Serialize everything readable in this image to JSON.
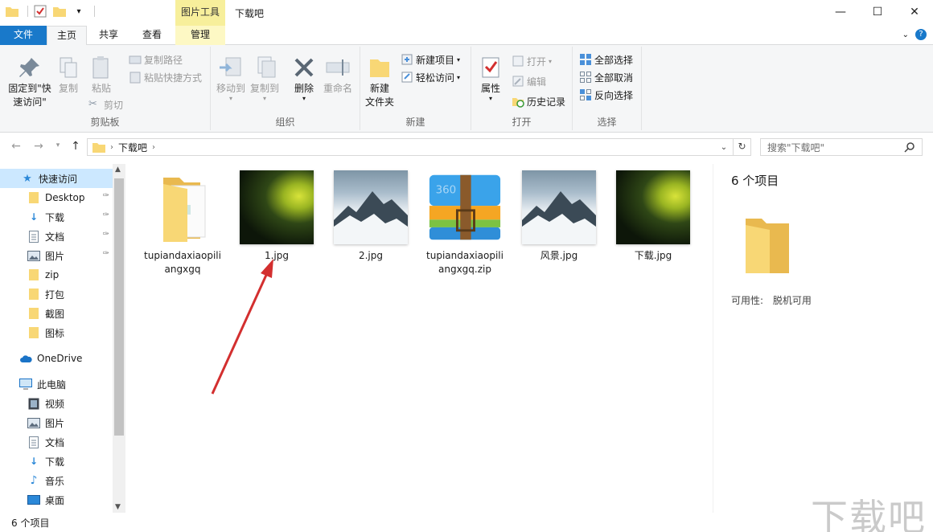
{
  "window": {
    "title": "下载吧",
    "context_tab_header": "图片工具",
    "controls": [
      "—",
      "☐",
      "✕"
    ]
  },
  "tabs": {
    "file": "文件",
    "home": "主页",
    "share": "共享",
    "view": "查看",
    "manage": "管理"
  },
  "ribbon": {
    "clipboard": {
      "label": "剪贴板",
      "pin": "固定到\"快\n速访问\"",
      "copy": "复制",
      "paste": "粘贴",
      "copy_path": "复制路径",
      "paste_shortcut": "粘贴快捷方式",
      "cut": "剪切"
    },
    "organize": {
      "label": "组织",
      "move_to": "移动到",
      "copy_to": "复制到",
      "delete": "删除",
      "rename": "重命名"
    },
    "new": {
      "label": "新建",
      "new_folder": "新建\n文件夹",
      "new_item": "新建项目",
      "easy_access": "轻松访问"
    },
    "open": {
      "label": "打开",
      "properties": "属性",
      "open": "打开",
      "edit": "编辑",
      "history": "历史记录"
    },
    "select": {
      "label": "选择",
      "select_all": "全部选择",
      "select_none": "全部取消",
      "invert": "反向选择"
    }
  },
  "address": {
    "crumb": "下载吧",
    "search_placeholder": "搜索\"下载吧\""
  },
  "nav": {
    "quick_access": "快速访问",
    "items": [
      {
        "label": "Desktop",
        "pinned": true
      },
      {
        "label": "下载",
        "pinned": true
      },
      {
        "label": "文档",
        "pinned": true
      },
      {
        "label": "图片",
        "pinned": true
      },
      {
        "label": "zip"
      },
      {
        "label": "打包"
      },
      {
        "label": "截图"
      },
      {
        "label": "图标"
      }
    ],
    "onedrive": "OneDrive",
    "this_pc": "此电脑",
    "pc_items": [
      "视频",
      "图片",
      "文档",
      "下载",
      "音乐",
      "桌面"
    ]
  },
  "files": [
    {
      "name": "tupiandaxiaopiliangxgq",
      "kind": "folder"
    },
    {
      "name": "1.jpg",
      "kind": "photo-dark"
    },
    {
      "name": "2.jpg",
      "kind": "photo-mountain"
    },
    {
      "name": "tupiandaxiaopiliangxgq.zip",
      "kind": "zip"
    },
    {
      "name": "风景.jpg",
      "kind": "photo-mountain"
    },
    {
      "name": "下载.jpg",
      "kind": "photo-dark"
    }
  ],
  "details": {
    "count": "6 个项目",
    "availability": "可用性:",
    "availability_value": "脱机可用"
  },
  "status": {
    "count": "6 个项目"
  },
  "watermark": "下载吧",
  "colors": {
    "accent": "#1979ca",
    "selected_bg": "#cce8ff",
    "folder": "#f8d775",
    "context_tab": "#f7ef9b",
    "arrow": "#d32f2f"
  }
}
